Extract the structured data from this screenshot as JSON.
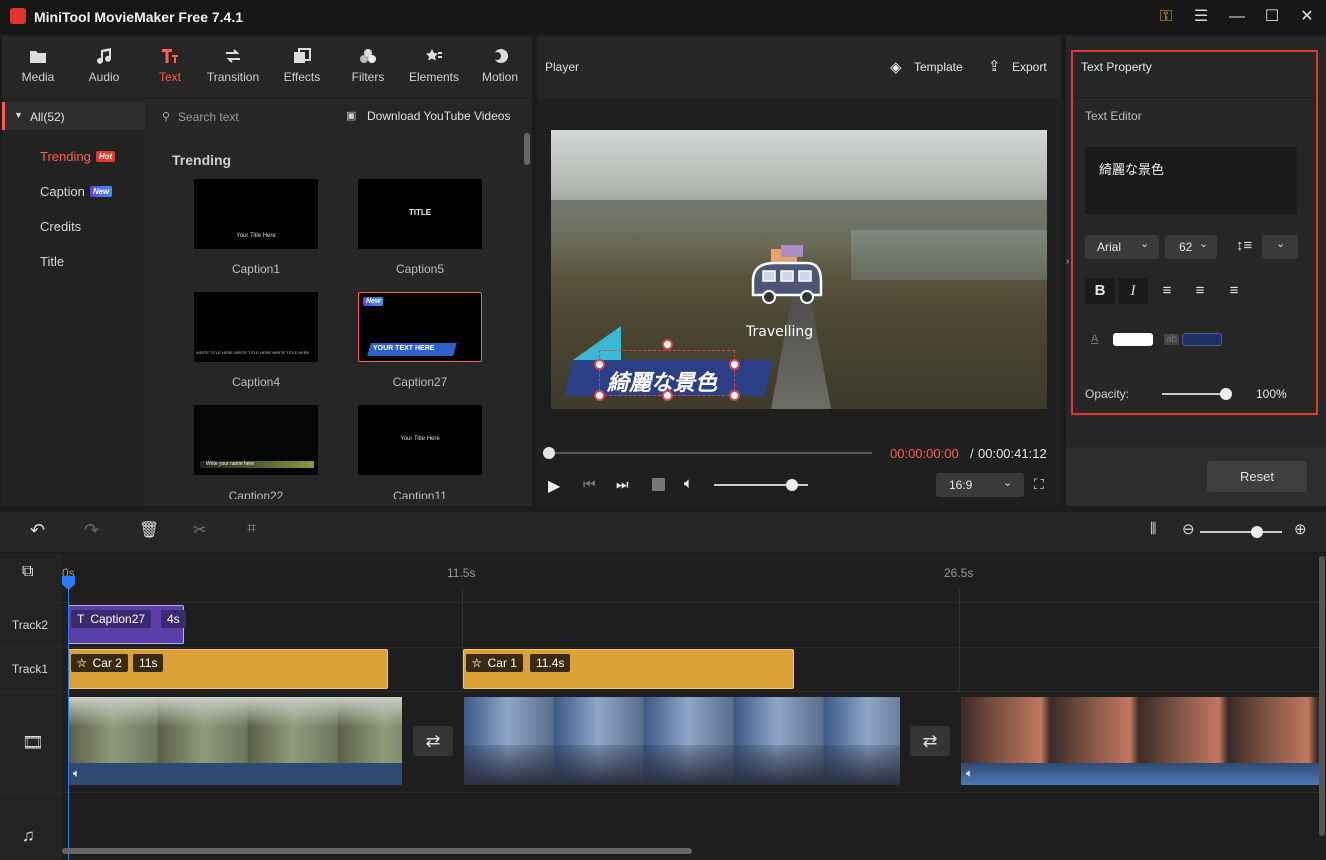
{
  "app": {
    "title": "MiniTool MovieMaker Free 7.4.1"
  },
  "toolbar": {
    "items": [
      {
        "label": "Media",
        "icon": "folder-icon"
      },
      {
        "label": "Audio",
        "icon": "music-note-icon"
      },
      {
        "label": "Text",
        "icon": "text-icon"
      },
      {
        "label": "Transition",
        "icon": "transition-icon"
      },
      {
        "label": "Effects",
        "icon": "effects-icon"
      },
      {
        "label": "Filters",
        "icon": "filters-icon"
      },
      {
        "label": "Elements",
        "icon": "elements-icon"
      },
      {
        "label": "Motion",
        "icon": "motion-icon"
      }
    ],
    "active": "Text"
  },
  "library": {
    "all_label": "All(52)",
    "search_placeholder": "Search text",
    "download_label": "Download YouTube Videos",
    "categories": [
      {
        "label": "Trending",
        "badge": "Hot"
      },
      {
        "label": "Caption",
        "badge": "New"
      },
      {
        "label": "Credits"
      },
      {
        "label": "Title"
      }
    ],
    "section_title": "Trending",
    "items": [
      {
        "label": "Caption1",
        "preview_text": "Your Title Here"
      },
      {
        "label": "Caption5",
        "preview_text": "TITLE"
      },
      {
        "label": "Caption4",
        "preview_text": "WRITE TITLE HERE WRITE TITLE HERE WRITE TITLE HERE"
      },
      {
        "label": "Caption27",
        "preview_text": "YOUR TEXT HERE",
        "badge": "New"
      },
      {
        "label": "Caption22",
        "preview_text": "Write your name here"
      },
      {
        "label": "Caption11",
        "preview_text": "Your Title Here"
      }
    ]
  },
  "player": {
    "title": "Player",
    "template_label": "Template",
    "export_label": "Export",
    "overlay_text": "綺麗な景色",
    "sticker_text": "Travelling",
    "current_time": "00:00:00:00",
    "separator": "/",
    "total_time": "00:00:41:12",
    "aspect_ratio": "16:9",
    "progress": 0,
    "volume": 0.83
  },
  "text_property": {
    "title": "Text Property",
    "editor_label": "Text Editor",
    "text_value": "綺麗な景色",
    "font": "Arial",
    "size": "62",
    "text_color": "#ffffff",
    "bg_color": "#1d3165",
    "color_icon_label": "A",
    "bg_icon_label": "ab",
    "opacity_label": "Opacity:",
    "opacity_value": "100%",
    "opacity": 1.0,
    "reset_label": "Reset"
  },
  "timeline": {
    "ruler": [
      "0s",
      "11.5s",
      "26.5s"
    ],
    "tracks": {
      "track2_label": "Track2",
      "track1_label": "Track1"
    },
    "caption_clip": {
      "name": "Caption27",
      "duration": "4s",
      "icon": "T"
    },
    "car2_clip": {
      "name": "Car 2",
      "duration": "11s"
    },
    "car1_clip": {
      "name": "Car 1",
      "duration": "11.4s"
    },
    "zoom": 0.7
  },
  "colors": {
    "accent": "#ff5b50",
    "highlight_border": "#e03a30",
    "caption_clip": "#5b3ea8",
    "element_clip": "#dba038",
    "playhead": "#2a7df3"
  }
}
